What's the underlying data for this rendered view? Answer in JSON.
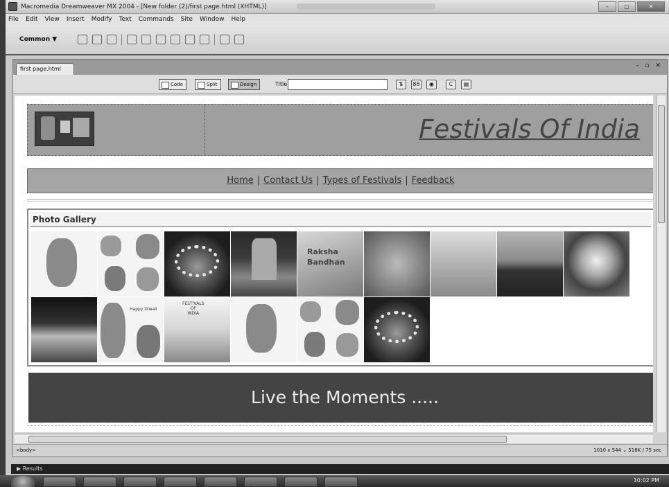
{
  "window": {
    "title": "Macromedia Dreamweaver MX 2004 - [New folder (2)/first page.html (XHTML)]",
    "controls": [
      "–",
      "▢",
      "✕"
    ]
  },
  "menubar": [
    "File",
    "Edit",
    "View",
    "Insert",
    "Modify",
    "Text",
    "Commands",
    "Site",
    "Window",
    "Help"
  ],
  "insertbar": {
    "category": "Common ▼",
    "icons": [
      "hyperlink-icon",
      "email-icon",
      "anchor-icon",
      "table-icon",
      "layer-icon",
      "image-icon",
      "media-icon",
      "date-icon",
      "comment-icon",
      "template-icon",
      "tag-chooser-icon"
    ]
  },
  "document": {
    "tab_label": "first page.html",
    "tab_controls": "– ▫ ✕",
    "view_buttons": {
      "code": "Code",
      "split": "Split",
      "design": "Design"
    },
    "title_label": "Title:",
    "title_value": "",
    "toolbar_icons": {
      "file_mgmt": "⇅",
      "preview": "◉",
      "refresh": "C",
      "options": "▤",
      "validate": "88"
    }
  },
  "page": {
    "site_title": "Festivals Of India",
    "nav": [
      "Home",
      "Contact Us",
      "Types of Festivals",
      "Feedback"
    ],
    "nav_separator": "|",
    "gallery_title": "Photo Gallery",
    "gallery_thumb_texts": {
      "raksha": "Raksha\nBandhan",
      "festivals_card": "FESTIVALS\nOF\nINDIA",
      "greeting": "Happy Diwali"
    },
    "footer_text": "Live the Moments ....."
  },
  "statusbar": {
    "tag_selector": "<body>",
    "doc_info": "1010 x 544 ⌄ 518K / 75 sec"
  },
  "results_panel": "▶ Results",
  "taskbar": {
    "clock": "10:02 PM"
  }
}
